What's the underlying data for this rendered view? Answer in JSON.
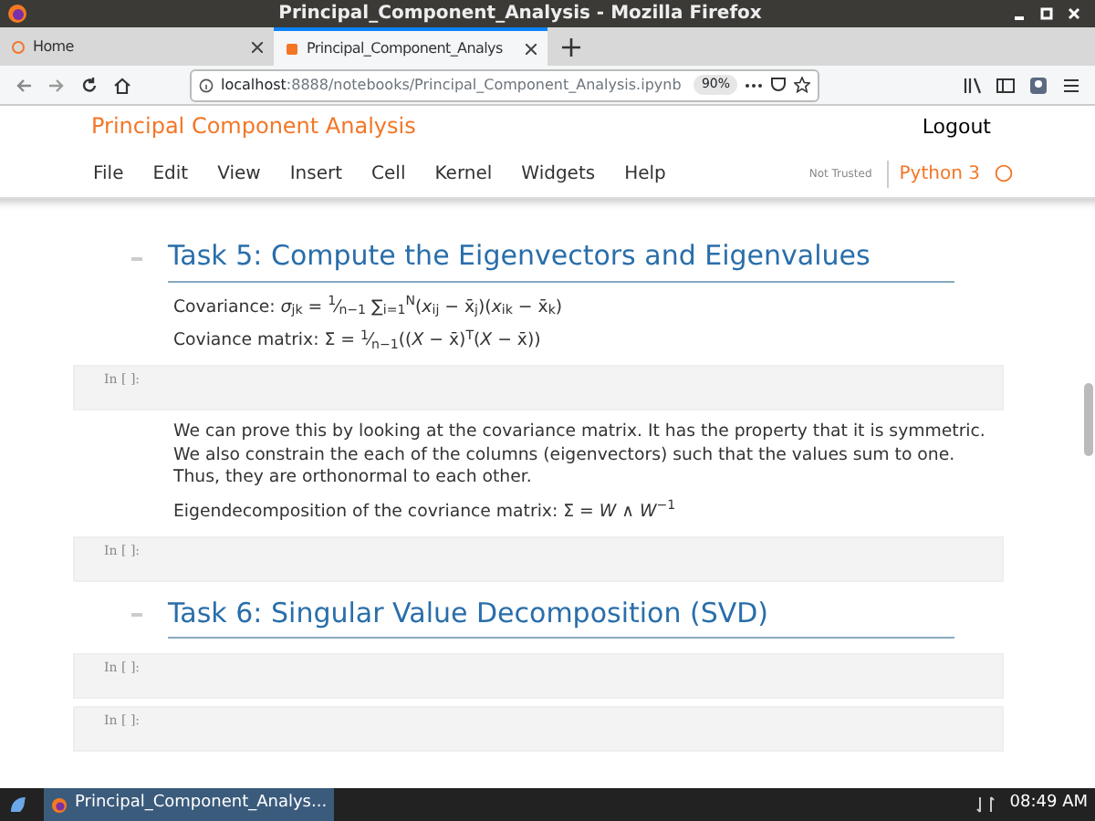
{
  "window": {
    "title": "Principal_Component_Analysis - Mozilla Firefox"
  },
  "tabs": [
    {
      "label": "Home",
      "selected": false
    },
    {
      "label": "Principal_Component_Analys",
      "selected": true
    }
  ],
  "address_bar": {
    "host": "localhost",
    "path": ":8888/notebooks/Principal_Component_Analysis.ipynb",
    "zoom": "90%"
  },
  "notebook_header": {
    "title": "Principal Component Analysis",
    "logout": "Logout"
  },
  "menu": [
    "File",
    "Edit",
    "View",
    "Insert",
    "Cell",
    "Kernel",
    "Widgets",
    "Help"
  ],
  "trust": "Not Trusted",
  "kernel": "Python 3",
  "cells": [
    {
      "kind": "heading",
      "text": "Task 5: Compute the Eigenvectors and Eigenvalues"
    },
    {
      "kind": "markdown",
      "paragraphs": [
        "Covariance: *σ*$_{jk}$ = $^{1}$⁄$_{n−1}$ ∑$_{i=1}$$^{N}$(*x*$_{ij}$ − x̄$_{j}$)(*x*$_{ik}$ − x̄$_{k}$)",
        "Coviance matrix: Σ = $^{1}$⁄$_{n−1}$((*X* − x̄)$^{T}$(*X* − x̄))"
      ]
    },
    {
      "kind": "code",
      "prompt": "In [ ]:"
    },
    {
      "kind": "markdown",
      "paragraphs": [
        "We can prove this by looking at the covariance matrix. It has the property that it is symmetric. We also constrain the each of the columns (eigenvectors) such that the values sum to one. Thus, they are orthonormal to each other.",
        "Eigendecomposition of the covriance matrix: Σ = *W* ∧ *W*$^{−1}$"
      ]
    },
    {
      "kind": "code",
      "prompt": "In [ ]:"
    },
    {
      "kind": "heading",
      "text": "Task 6: Singular Value Decomposition (SVD)"
    },
    {
      "kind": "code",
      "prompt": "In [ ]:"
    },
    {
      "kind": "code",
      "prompt": "In [ ]:"
    }
  ],
  "taskbar": {
    "window": "Principal_Component_Analys...",
    "clock": "08:49 AM"
  }
}
